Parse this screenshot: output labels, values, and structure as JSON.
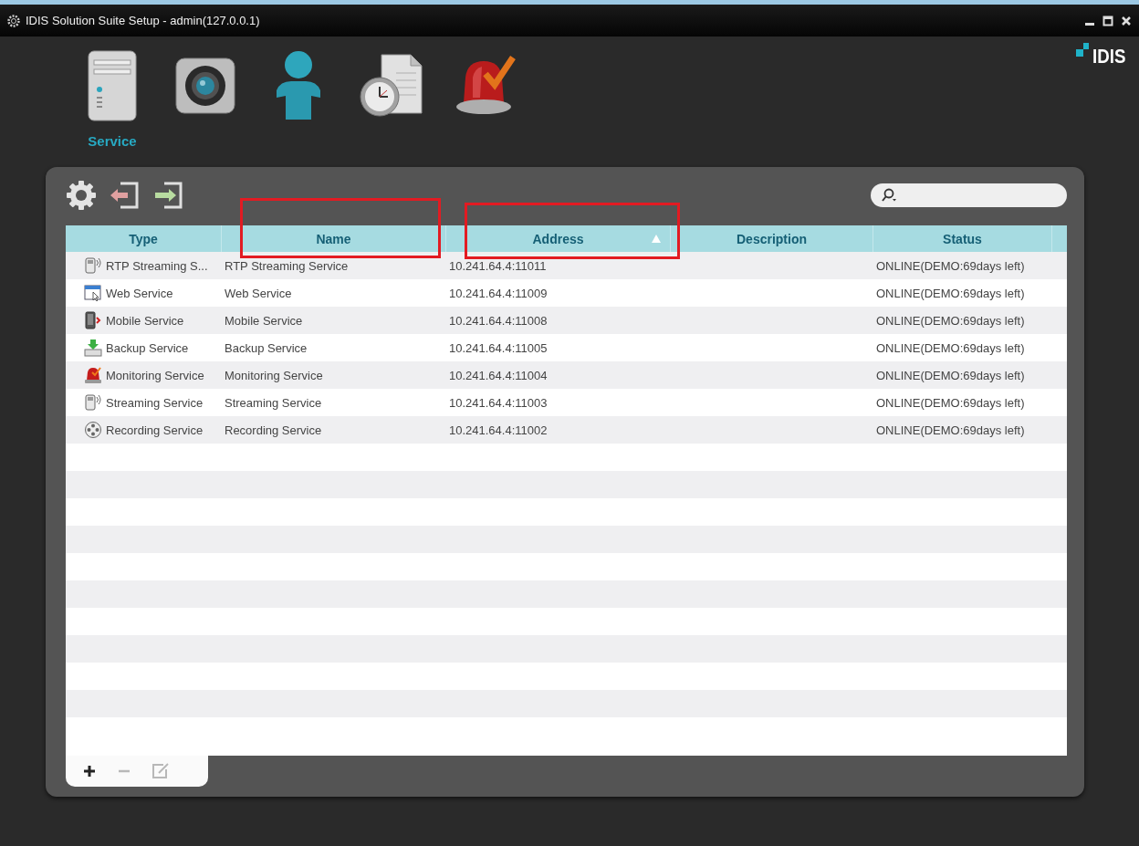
{
  "window": {
    "title": "IDIS Solution Suite Setup - admin(127.0.0.1)"
  },
  "brand": {
    "logo": "IDIS"
  },
  "nav": [
    {
      "kind": "server",
      "label": "Service",
      "selected": true
    },
    {
      "kind": "camera",
      "selected": false
    },
    {
      "kind": "user",
      "selected": false
    },
    {
      "kind": "schedule",
      "selected": false
    },
    {
      "kind": "alarm",
      "selected": false
    }
  ],
  "toolbar": [
    {
      "kind": "settings"
    },
    {
      "kind": "import"
    },
    {
      "kind": "export"
    }
  ],
  "table": {
    "columns": [
      {
        "label": "Type",
        "highlighted": false,
        "sorted": false
      },
      {
        "label": "Name",
        "highlighted": true,
        "sorted": false
      },
      {
        "label": "Address",
        "highlighted": true,
        "sorted": true
      },
      {
        "label": "Description",
        "highlighted": false,
        "sorted": false
      },
      {
        "label": "Status",
        "highlighted": false,
        "sorted": false
      }
    ],
    "rows": [
      {
        "kind": "streaming",
        "type": "RTP Streaming S...",
        "name": "RTP Streaming Service",
        "address": "10.241.64.4:11011",
        "status": "ONLINE(DEMO:69days left)"
      },
      {
        "kind": "web",
        "type": "Web Service",
        "name": "Web Service",
        "address": "10.241.64.4:11009",
        "status": "ONLINE(DEMO:69days left)"
      },
      {
        "kind": "mobile",
        "type": "Mobile Service",
        "name": "Mobile Service",
        "address": "10.241.64.4:11008",
        "status": "ONLINE(DEMO:69days left)"
      },
      {
        "kind": "backup",
        "type": "Backup Service",
        "name": "Backup Service",
        "address": "10.241.64.4:11005",
        "status": "ONLINE(DEMO:69days left)"
      },
      {
        "kind": "monitoring",
        "type": "Monitoring Service",
        "name": "Monitoring Service",
        "address": "10.241.64.4:11004",
        "status": "ONLINE(DEMO:69days left)"
      },
      {
        "kind": "streaming",
        "type": "Streaming Service",
        "name": "Streaming Service",
        "address": "10.241.64.4:11003",
        "status": "ONLINE(DEMO:69days left)"
      },
      {
        "kind": "recording",
        "type": "Recording Service",
        "name": "Recording Service",
        "address": "10.241.64.4:11002",
        "status": "ONLINE(DEMO:69days left)"
      }
    ]
  },
  "footer": [
    {
      "kind": "add",
      "disabled": false
    },
    {
      "kind": "remove",
      "disabled": true
    },
    {
      "kind": "edit",
      "disabled": true
    }
  ]
}
